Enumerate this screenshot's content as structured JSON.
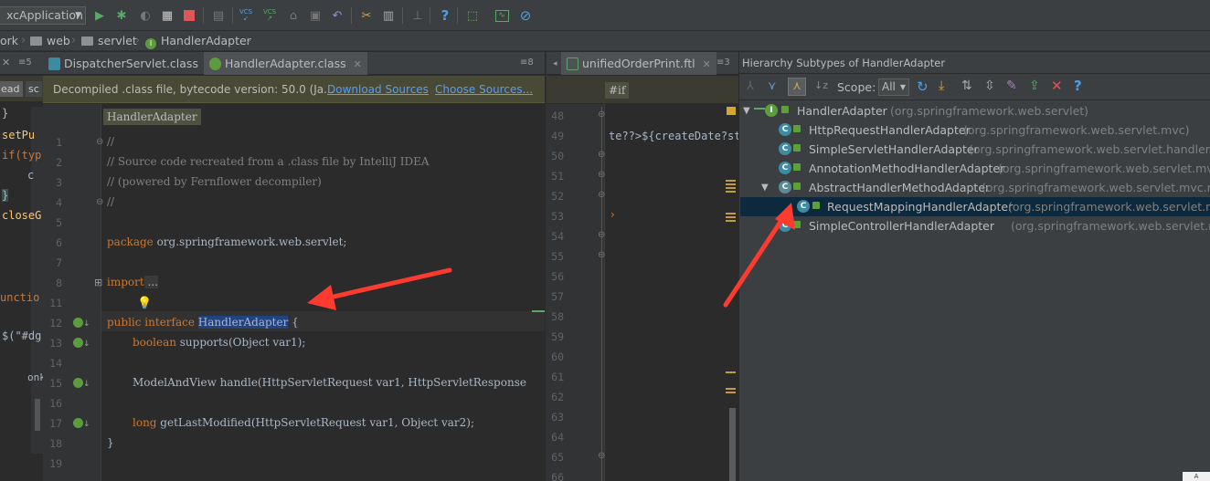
{
  "toolbar": {
    "run_config": "xcApplication",
    "icons": [
      "run-icon",
      "debug-icon",
      "coverage-icon",
      "profile-icon",
      "stop-icon",
      "build-icon",
      "vcs-update-icon",
      "vcs-commit-icon",
      "vcs-history-icon",
      "vcs-compare-icon",
      "revert-icon",
      "settings-icon",
      "project-structure-icon",
      "sdk-icon",
      "help-icon",
      "plugin-icon",
      "monitor-icon",
      "no-entry-icon"
    ],
    "vcs_label": "VCS"
  },
  "breadcrumb": {
    "items": [
      "ork",
      "web",
      "servlet",
      "HandlerAdapter"
    ]
  },
  "left_panel": {
    "tab_ctrl": "≡5",
    "snippets": [
      "}",
      "setPu",
      "if(typ",
      "c",
      "}",
      "closeG",
      "unctio",
      "$(\"#dg",
      "onk"
    ],
    "btn_ead": "ead",
    "btn_sc": "sc"
  },
  "editor": {
    "tabs": [
      {
        "label": "DispatcherServlet.class",
        "active": false
      },
      {
        "label": "HandlerAdapter.class",
        "active": true
      }
    ],
    "tab_ctrl": "≡8",
    "banner": {
      "text": "Decompiled .class file, bytecode version: 50.0 (Ja...",
      "download": "Download Sources",
      "choose": "Choose Sources..."
    },
    "breadcrumb_label": "HandlerAdapter",
    "line_numbers": [
      "1",
      "2",
      "3",
      "4",
      "5",
      "6",
      "7",
      "8",
      "11",
      "12",
      "13",
      "14",
      "15",
      "16",
      "17",
      "18",
      "19"
    ],
    "lines": {
      "l1": "//",
      "l2": "// Source code recreated from a .class file by IntelliJ IDEA",
      "l3": "// (powered by Fernflower decompiler)",
      "l4": "//",
      "l6_kw": "package",
      "l6_rest": " org.springframework.web.servlet;",
      "l8_kw": "import",
      "l8_rest": " ...",
      "l12_kw": "public interface",
      "l12_name": "HandlerAdapter",
      "l12_rest": " {",
      "l13_kw": "boolean",
      "l13_rest": " supports(Object var1);",
      "l15": "ModelAndView handle(HttpServletRequest var1, HttpServletResponse",
      "l17_kw": "long",
      "l17_rest": " getLastModified(HttpServletRequest var1, Object var2);",
      "l18": "}"
    }
  },
  "ftl_editor": {
    "tab_label": "unifiedOrderPrint.ftl",
    "tab_ctrl": "≡3",
    "breadcrumb_label": "#if",
    "line_numbers": [
      "48",
      "49",
      "50",
      "51",
      "52",
      "53",
      "54",
      "55",
      "56",
      "57",
      "58",
      "59",
      "60",
      "61",
      "62",
      "63",
      "64",
      "65",
      "66"
    ],
    "line49": "te??>${createDate?st"
  },
  "hierarchy": {
    "title": "Hierarchy Subtypes of HandlerAdapter",
    "scope_label": "Scope:",
    "scope_value": "All",
    "rows": [
      {
        "name": "HandlerAdapter",
        "pkg": "(org.springframework.web.servlet)"
      },
      {
        "name": "HttpRequestHandlerAdapter",
        "pkg": "(org.springframework.web.servlet.mvc)"
      },
      {
        "name": "SimpleServletHandlerAdapter",
        "pkg": "(org.springframework.web.servlet.handler)"
      },
      {
        "name": "AnnotationMethodHandlerAdapter",
        "pkg": "(org.springframework.web.servlet.mvc.a"
      },
      {
        "name": "AbstractHandlerMethodAdapter",
        "pkg": "(org.springframework.web.servlet.mvc.met"
      },
      {
        "name": "RequestMappingHandlerAdapter",
        "pkg": "(org.springframework.web.servlet.mvc"
      },
      {
        "name": "SimpleControllerHandlerAdapter",
        "pkg": "(org.springframework.web.servlet.mvc)"
      }
    ]
  },
  "colors": {
    "accent_red": "#ff3b30",
    "selection": "#214283",
    "keyword": "#cc7832"
  }
}
